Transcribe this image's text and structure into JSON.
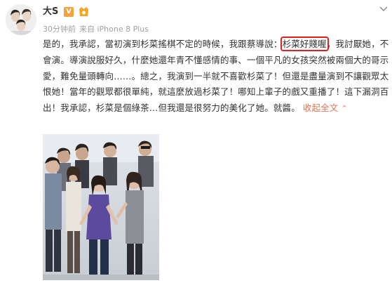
{
  "user": {
    "name": "大S",
    "verified_badge": "V",
    "member_badge_icon": "member-badge-icon"
  },
  "meta": {
    "time": "30分钟前",
    "source": "来自 iPhone 8 Plus"
  },
  "post": {
    "part1": "是的，我承認，當初演到杉菜搖棋不定的時候，我跟蔡導說：",
    "highlight": "杉菜好賤喔",
    "part2": "，我討厭她，不會演。導演說服好久，什麼她還年青不懂感情的事、一個平凡的女孩突然被兩個大的哥示愛，難免量頭轉向……。總之，我演到一半就不喜歡杉菜了！但還是盡量演到不讓觀眾太恨她！當年的觀眾都很單純，就這麼放過杉菜了！哪知上輩子的戲又重播了！這下漏洞百出！我承認，杉菜是個綠茶…但我還是很努力的美化了她。就醬。",
    "collapse_label": "收起全文",
    "caret": "⌃"
  },
  "colors": {
    "highlight_border": "#e4201f",
    "link": "#eb7350",
    "meta": "#a0a0a0"
  }
}
